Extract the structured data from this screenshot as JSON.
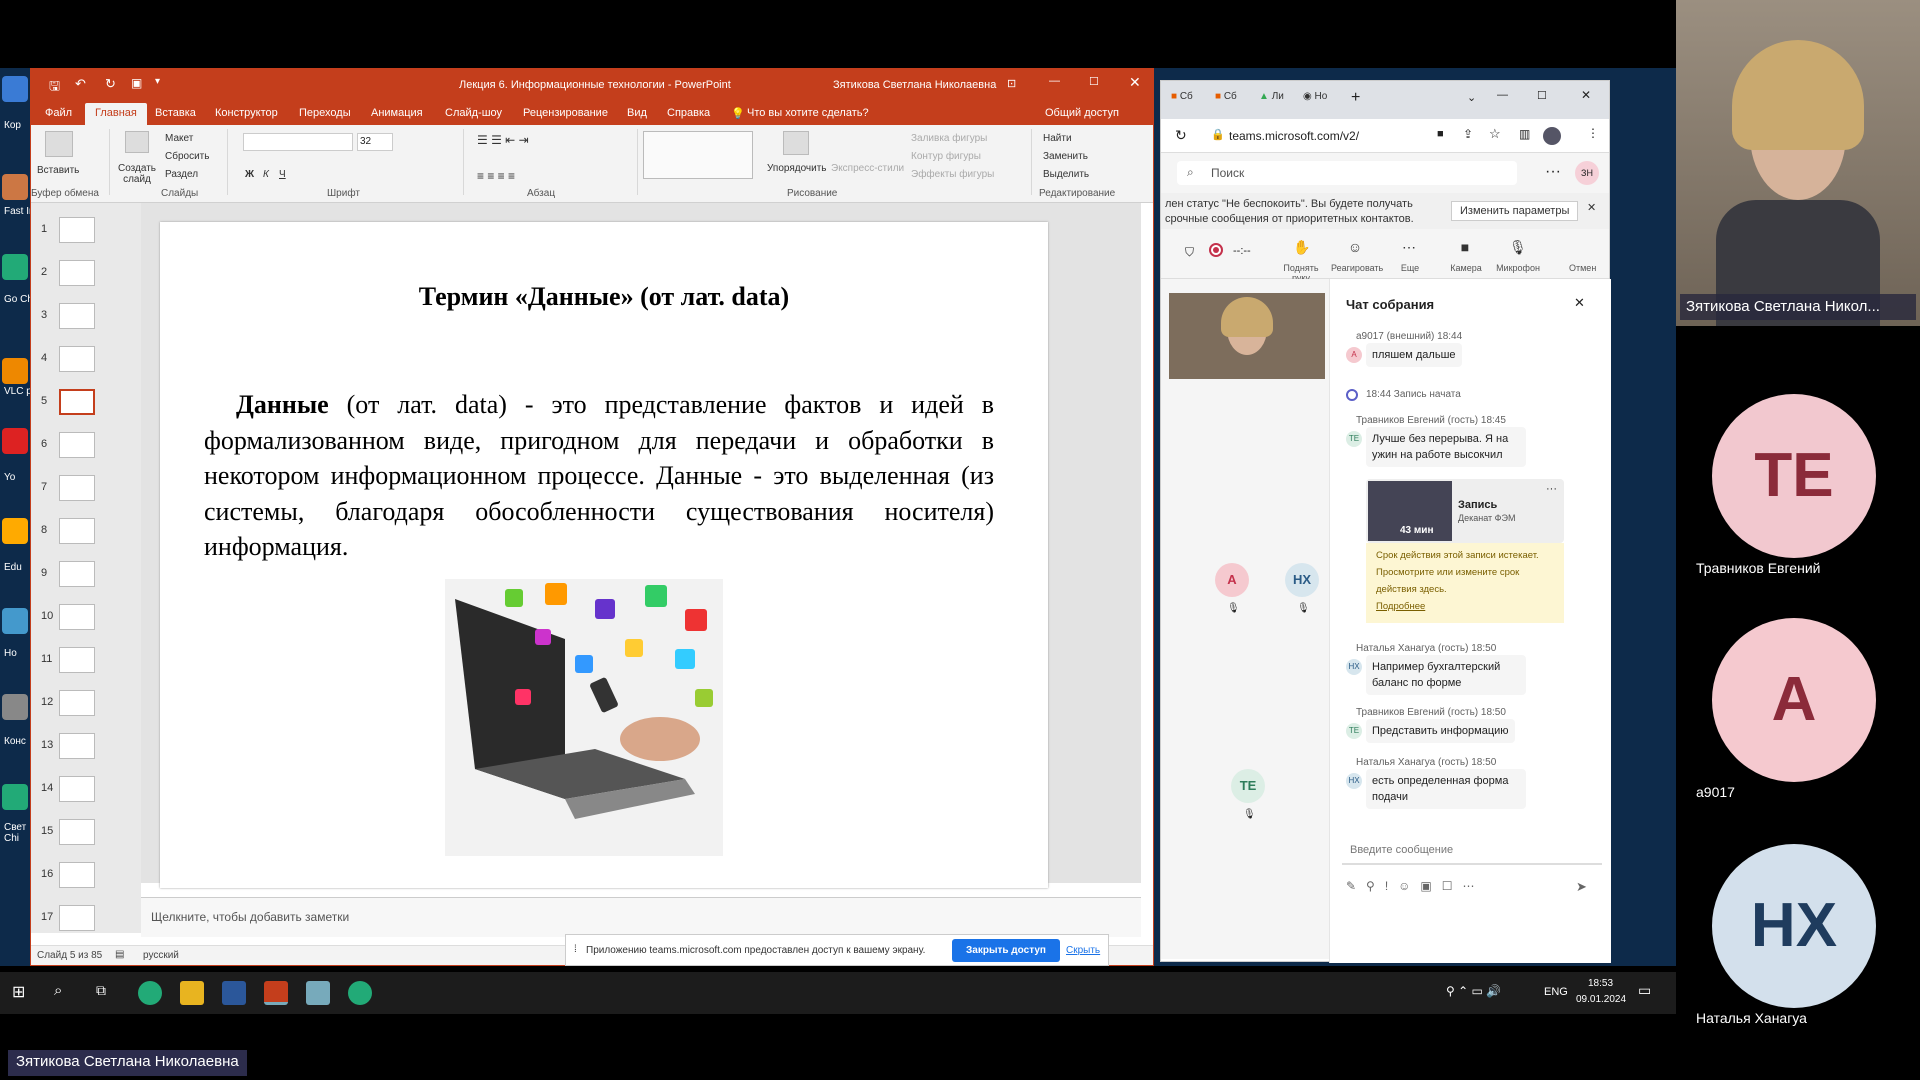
{
  "ppt": {
    "title": "Лекция 6. Информационные технологии - PowerPoint",
    "user": "Зятикова Светлана Николаевна",
    "tabs": [
      "Файл",
      "Главная",
      "Вставка",
      "Конструктор",
      "Переходы",
      "Анимация",
      "Слайд-шоу",
      "Рецензирование",
      "Вид",
      "Справка"
    ],
    "tell_me": "Что вы хотите сделать?",
    "share": "Общий доступ",
    "ribbon": {
      "paste": "Вставить",
      "clipboard": "Буфер обмена",
      "new_slide": "Создать слайд",
      "layout": "Макет",
      "reset": "Сбросить",
      "section": "Раздел",
      "slides": "Слайды",
      "font_size": "32",
      "font": "Шрифт",
      "paragraph": "Абзац",
      "arrange": "Упорядочить",
      "quick_styles": "Экспресс-стили",
      "fill": "Заливка фигуры",
      "outline": "Контур фигуры",
      "effects": "Эффекты фигуры",
      "drawing": "Рисование",
      "find": "Найти",
      "replace": "Заменить",
      "select": "Выделить",
      "editing": "Редактирование"
    },
    "thumbs": [
      "1",
      "2",
      "3",
      "4",
      "5",
      "6",
      "7",
      "8",
      "9",
      "10",
      "11",
      "12",
      "13",
      "14",
      "15",
      "16",
      "17"
    ],
    "slide": {
      "title": "Термин «Данные» (от лат. data)",
      "bold_word": "Данные",
      "body": " (от лат. data) - это представление фактов и идей в формализованном виде, пригодном для передачи и обработки в некотором информационном процессе. Данные - это выделенная (из системы, благодаря обособленности существования носителя) информация."
    },
    "notes": "Щелкните, чтобы добавить заметки",
    "status": {
      "slide": "Слайд 5 из 85",
      "lang": "русский"
    },
    "share_bar": {
      "text": "Приложению teams.microsoft.com предоставлен доступ к вашему экрану.",
      "stop": "Закрыть доступ",
      "hide": "Скрыть"
    }
  },
  "browser": {
    "tabs": [
      "Сб",
      "Сб",
      "Ли",
      "Но"
    ],
    "url": "teams.microsoft.com/v2/",
    "search": "Поиск",
    "me": "ЗН",
    "notice": "лен статус \"Не беспокоить\". Вы будете получать срочные сообщения от приоритетных контактов.",
    "notice_btn": "Изменить параметры",
    "timer": "--:--",
    "toolbar": [
      "Поднять руку",
      "Реагировать",
      "Еще",
      "Камера",
      "Микрофон",
      "Отмен"
    ],
    "stage_avatars": [
      "A",
      "НХ",
      "ТЕ"
    ],
    "chat": {
      "title": "Чат собрания",
      "m1_meta": "a9017 (внешний)  18:44",
      "m1": "пляшем дальше",
      "rec_meta": "18:44  Запись начата",
      "m2_meta": "Травников Евгений (гость)  18:45",
      "m2": "Лучше без перерыва. Я на ужин на работе высокчил",
      "rec_title": "Запись",
      "rec_sub": "Деканат ФЭМ",
      "rec_dur": "43 мин",
      "rec_warn": "Срок действия этой записи истекает. Просмотрите или измените срок действия здесь.",
      "rec_more": "Подробнее",
      "m3_meta": "Наталья Ханагуа (гость)  18:50",
      "m3": "Например бухгалтерский баланс по форме",
      "m4_meta": "Травников Евгений (гость)  18:50",
      "m4": "Представить информацию",
      "m5_meta": "Наталья Ханагуа (гость)  18:50",
      "m5": "есть определенная форма подачи",
      "input": "Введите сообщение",
      "av_a": "A",
      "av_te": "ТЕ",
      "av_nh": "НХ"
    }
  },
  "participants": {
    "video_name": "Зятикова Светлана Никол...",
    "p": [
      {
        "init": "ТЕ",
        "name": "Травников Евгений"
      },
      {
        "init": "A",
        "name": "a9017"
      },
      {
        "init": "НХ",
        "name": "Наталья Ханагуа"
      }
    ]
  },
  "taskbar": {
    "lang": "ENG",
    "time": "18:53",
    "date": "09.01.2024"
  },
  "desktop_labels": [
    "Кор",
    "Fast Image",
    "Go Chi",
    "VLC pl",
    "Yo",
    "Edu",
    "Ho",
    "Конс",
    "Свет Chi"
  ],
  "speaker": "Зятикова Светлана Николаевна",
  "colors": {
    "ppt": "#c43e1c",
    "teams": "#5b5fc7",
    "te": "#f2c8cf",
    "a": "#f5c9cf",
    "nh": "#d3e0ec"
  }
}
